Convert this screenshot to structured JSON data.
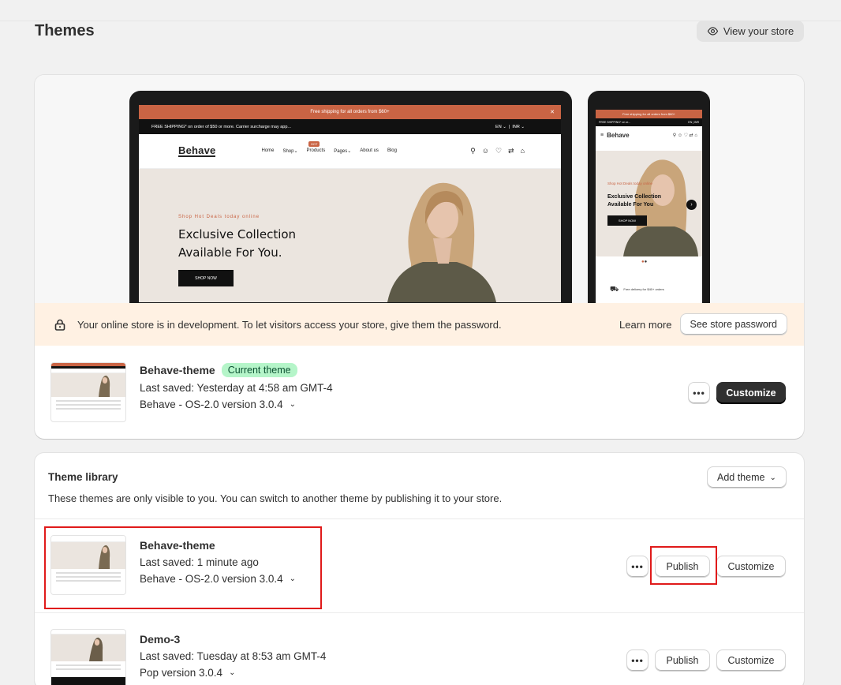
{
  "page": {
    "title": "Themes",
    "view_store_label": "View your store"
  },
  "preview": {
    "announcement": "Free shipping for all orders from $60+",
    "shipping_bar": "FREE SHIPPING* on order of $50 or more. Carrier surcharge may app...",
    "locale": "EN",
    "currency": "INR",
    "logo": "Behave",
    "nav": [
      "Home",
      "Shop",
      "Products",
      "Pages",
      "About us",
      "Blog"
    ],
    "hot_badge": "HOT",
    "kicker": "Shop Hot Deals today online",
    "headline_1": "Exclusive Collection",
    "headline_2": "Available For You.",
    "cta": "SHOP NOW",
    "mobile_announcement": "Free shipping for all orders from $60+",
    "mobile_shipping": "FREE SHIPPING* on or...",
    "mobile_kicker": "Shop Hot Deals today online",
    "mobile_headline_1": "Exclusive Collection",
    "mobile_headline_2": "Available For You",
    "mobile_cta": "SHOP NOW",
    "mobile_footer": "Free delivery for $40+ orders"
  },
  "dev_banner": {
    "message": "Your online store is in development. To let visitors access your store, give them the password.",
    "learn_more": "Learn more",
    "button": "See store password"
  },
  "current_theme": {
    "name": "Behave-theme",
    "badge": "Current theme",
    "last_saved": "Last saved: Yesterday at 4:58 am GMT-4",
    "version": "Behave - OS-2.0 version 3.0.4",
    "more_label": "•••",
    "customize_label": "Customize"
  },
  "library": {
    "title": "Theme library",
    "description": "These themes are only visible to you. You can switch to another theme by publishing it to your store.",
    "add_theme_label": "Add theme",
    "themes": [
      {
        "name": "Behave-theme",
        "last_saved": "Last saved: 1 minute ago",
        "version": "Behave - OS-2.0 version 3.0.4",
        "more_label": "•••",
        "publish_label": "Publish",
        "customize_label": "Customize"
      },
      {
        "name": "Demo-3",
        "last_saved": "Last saved: Tuesday at 8:53 am GMT-4",
        "version": "Pop version 3.0.4",
        "more_label": "•••",
        "publish_label": "Publish",
        "customize_label": "Customize"
      }
    ]
  },
  "colors": {
    "accent": "#c96444",
    "primary_button": "#303030",
    "badge_bg": "#b5f5c9",
    "banner_bg": "#fff1e3",
    "highlight": "#e01a1a"
  }
}
